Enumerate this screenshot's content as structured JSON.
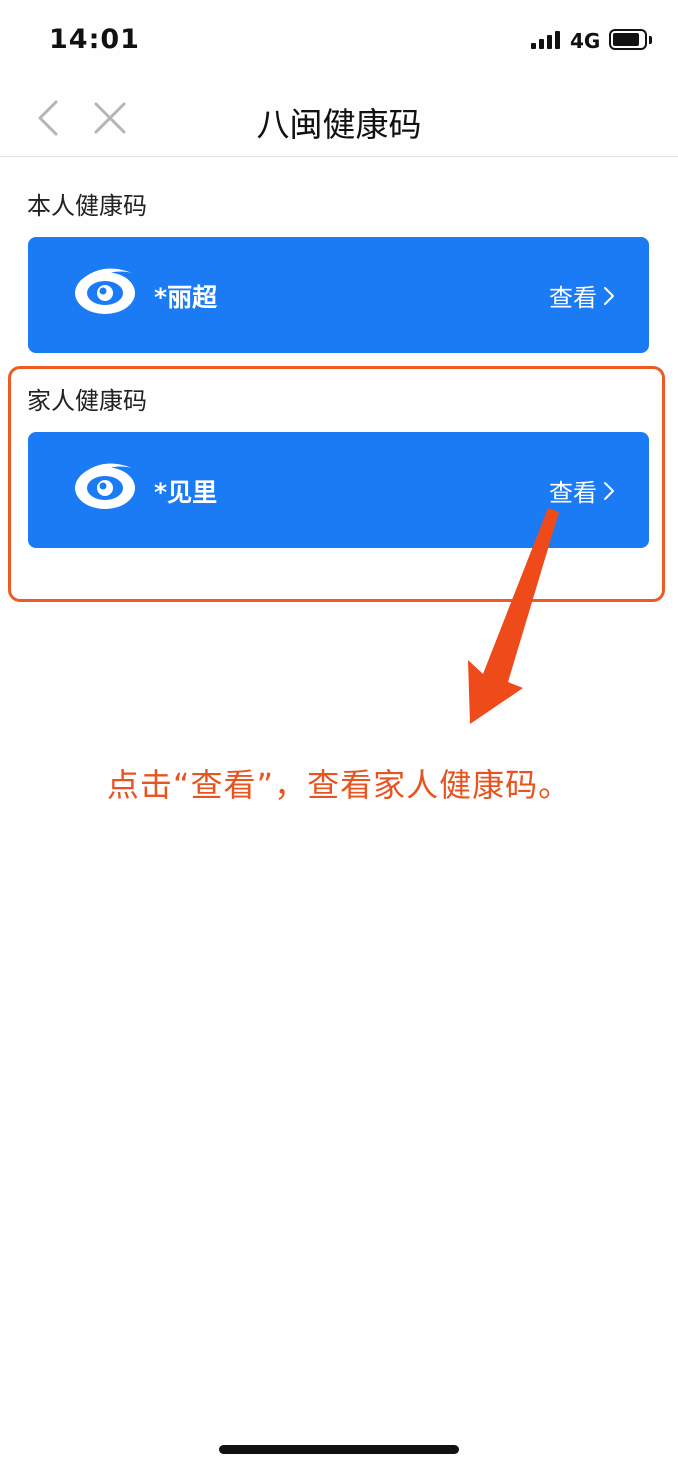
{
  "status_bar": {
    "time": "14:01",
    "network": "4G",
    "icons": [
      "signal-icon",
      "battery-icon"
    ]
  },
  "nav": {
    "title": "八闽健康码",
    "back_icon": "chevron-left-icon",
    "close_icon": "close-icon"
  },
  "self_section": {
    "label": "本人健康码",
    "card": {
      "name": "*丽超",
      "view_label": "查看",
      "logo_icon": "health-code-logo-icon",
      "color": "#1a7bf5"
    }
  },
  "family_section": {
    "label": "家人健康码",
    "card": {
      "name": "*见里",
      "view_label": "查看",
      "logo_icon": "health-code-logo-icon",
      "color": "#1a7bf5"
    }
  },
  "annotation": {
    "instruction": "点击“查看”，查看家人健康码。",
    "color": "#e8541f"
  }
}
